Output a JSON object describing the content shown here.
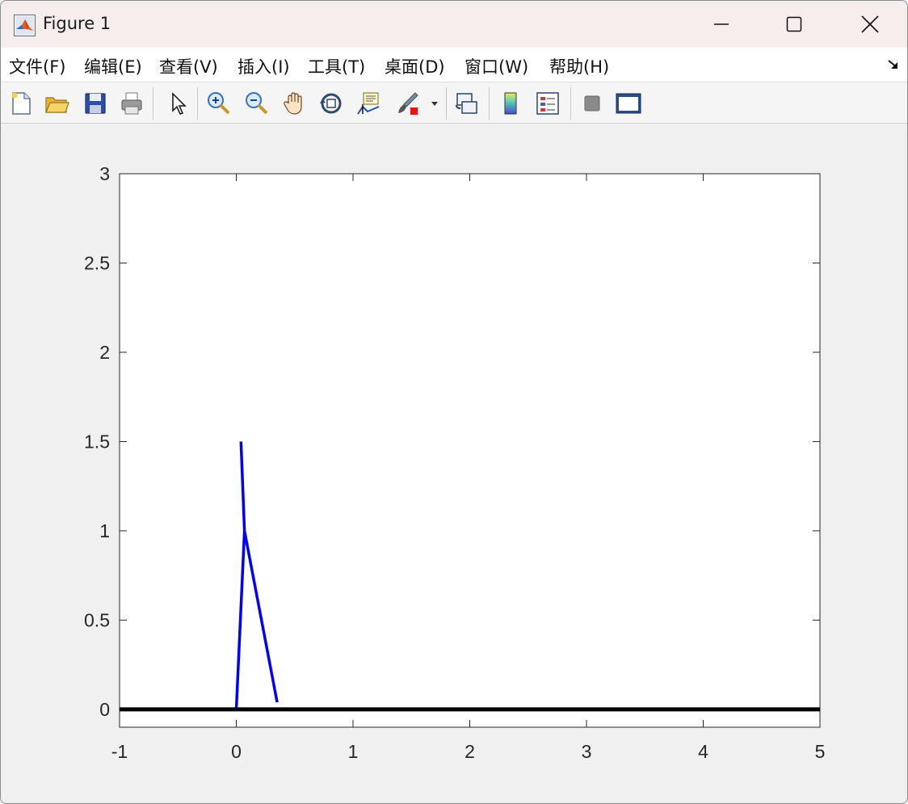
{
  "window": {
    "title": "Figure 1",
    "app_icon": "matlab-icon",
    "controls": [
      "minimize-icon",
      "maximize-icon",
      "close-icon"
    ]
  },
  "menu": {
    "items": [
      {
        "label": "文件(F)",
        "name": "menu-file"
      },
      {
        "label": "编辑(E)",
        "name": "menu-edit"
      },
      {
        "label": "查看(V)",
        "name": "menu-view"
      },
      {
        "label": "插入(I)",
        "name": "menu-insert"
      },
      {
        "label": "工具(T)",
        "name": "menu-tools"
      },
      {
        "label": "桌面(D)",
        "name": "menu-desktop"
      },
      {
        "label": "窗口(W)",
        "name": "menu-window"
      },
      {
        "label": "帮助(H)",
        "name": "menu-help"
      }
    ],
    "dock_icon": "dock-arrow-icon"
  },
  "toolbar": {
    "buttons": [
      "new-figure-icon",
      "open-file-icon",
      "save-icon",
      "print-icon",
      "select-arrow-icon",
      "zoom-in-icon",
      "zoom-out-icon",
      "pan-hand-icon",
      "rotate-3d-icon",
      "data-cursor-icon",
      "brush-icon",
      "brush-dropdown-icon",
      "link-plot-icon",
      "colorbar-icon",
      "legend-icon",
      "hide-plot-tools-icon",
      "show-plot-tools-icon"
    ]
  },
  "chart_data": {
    "type": "line",
    "title": "",
    "xlabel": "",
    "ylabel": "",
    "xlim": [
      -1,
      5
    ],
    "ylim": [
      -0.1,
      3
    ],
    "xticks": [
      "-1",
      "0",
      "1",
      "2",
      "3",
      "4",
      "5"
    ],
    "xtick_values": [
      -1,
      0,
      1,
      2,
      3,
      4,
      5
    ],
    "yticks": [
      "0",
      "0.5",
      "1",
      "1.5",
      "2",
      "2.5",
      "3"
    ],
    "ytick_values": [
      0,
      0.5,
      1,
      1.5,
      2,
      2.5,
      3
    ],
    "grid": false,
    "series": [
      {
        "color": "#0000ff",
        "segments": [
          {
            "x": [
              0.0,
              0.07
            ],
            "y": [
              0.0,
              1.0
            ]
          },
          {
            "x": [
              0.07,
              0.35
            ],
            "y": [
              1.0,
              0.04
            ]
          },
          {
            "x": [
              0.07,
              0.04
            ],
            "y": [
              1.0,
              1.5
            ]
          }
        ]
      },
      {
        "color": "#000000",
        "segments": [
          {
            "x": [
              -1,
              5
            ],
            "y": [
              0,
              0
            ]
          }
        ]
      }
    ]
  }
}
